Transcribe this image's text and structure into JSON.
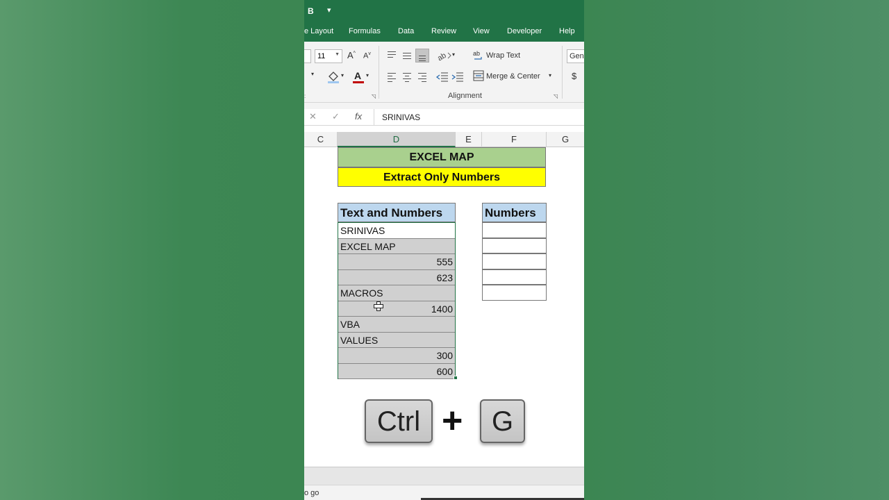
{
  "title_bar": {
    "bold_button": "B",
    "qat_dropdown": "▾"
  },
  "tabs": [
    {
      "label": "e Layout"
    },
    {
      "label": "Formulas"
    },
    {
      "label": "Data"
    },
    {
      "label": "Review"
    },
    {
      "label": "View"
    },
    {
      "label": "Developer"
    },
    {
      "label": "Help"
    }
  ],
  "ribbon": {
    "font_size": "11",
    "grow_font": "A",
    "shrink_font": "A",
    "wrap_text": "Wrap Text",
    "merge_center": "Merge & Center",
    "number_format": "Gene",
    "currency": "$",
    "alignment_group": "Alignment"
  },
  "formula_bar": {
    "value": "SRINIVAS"
  },
  "columns": [
    {
      "label": "C"
    },
    {
      "label": "D"
    },
    {
      "label": "E"
    },
    {
      "label": "F"
    },
    {
      "label": "G"
    }
  ],
  "sheet": {
    "banner_title": "EXCEL MAP",
    "banner_subtitle": "Extract Only Numbers",
    "header_text_numbers": "Text and Numbers",
    "header_numbers": "Numbers",
    "rows": [
      {
        "text": "SRINIVAS",
        "number": ""
      },
      {
        "text": "EXCEL MAP",
        "number": ""
      },
      {
        "text": "",
        "number": "555"
      },
      {
        "text": "",
        "number": "623"
      },
      {
        "text": "MACROS",
        "number": ""
      },
      {
        "text": "",
        "number": "1400"
      },
      {
        "text": "VBA",
        "number": ""
      },
      {
        "text": "VALUES",
        "number": ""
      },
      {
        "text": "",
        "number": "300"
      },
      {
        "text": "",
        "number": "600"
      }
    ]
  },
  "shortcut": {
    "key1": "Ctrl",
    "plus": "+",
    "key2": "G"
  },
  "status_bar": {
    "text": "o go"
  },
  "colors": {
    "excel_green": "#217346",
    "banner_green": "#a9d08e",
    "banner_yellow": "#ffff00",
    "header_blue": "#bdd7ee"
  }
}
